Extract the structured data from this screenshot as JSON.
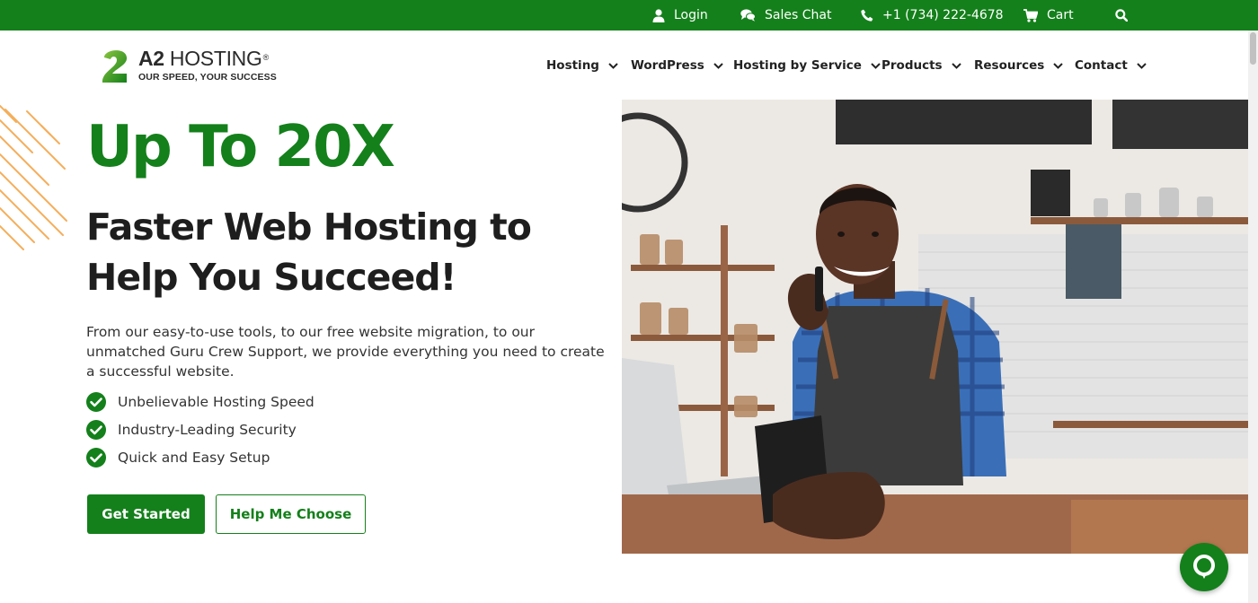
{
  "topbar": {
    "login": "Login",
    "sales_chat": "Sales Chat",
    "phone": "+1 (734) 222-4678",
    "cart": "Cart"
  },
  "logo": {
    "mark": "2",
    "brand_bold": "A2",
    "brand_rest": " HOSTING",
    "registered": "®",
    "tagline": "OUR SPEED, YOUR SUCCESS"
  },
  "nav": [
    "Hosting",
    "WordPress",
    "Hosting by Service",
    "Products",
    "Resources",
    "Contact"
  ],
  "hero": {
    "headline": "Up To 20X",
    "subheadline": "Faster Web Hosting to Help You Succeed!",
    "description": "From our easy-to-use tools, to our free website migration, to our unmatched Guru Crew Support, we provide everything you need to create a successful website.",
    "features": [
      "Unbelievable Hosting Speed",
      "Industry-Leading Security",
      "Quick and Easy Setup"
    ],
    "primary_cta": "Get Started",
    "secondary_cta": "Help Me Choose"
  },
  "colors": {
    "brand_green": "#14801b",
    "accent_orange": "#f4a64a",
    "text_dark": "#1e1e1e"
  },
  "icons": [
    "user-icon",
    "chat-icon",
    "phone-icon",
    "cart-icon",
    "search-icon",
    "chevron-down-icon",
    "check-circle-icon",
    "chat-bubble-icon"
  ]
}
